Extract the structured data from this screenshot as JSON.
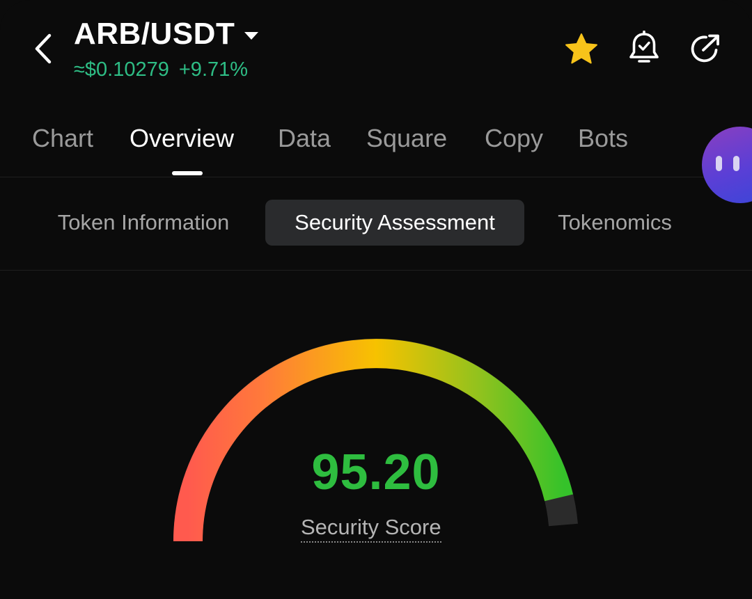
{
  "header": {
    "pair": "ARB/USDT",
    "price": "≈$0.10279",
    "change": "+9.71%",
    "icons": [
      "back-arrow-icon",
      "favorite-star-icon",
      "price-alert-bell-icon",
      "share-icon"
    ]
  },
  "main_tabs": [
    {
      "label": "Chart"
    },
    {
      "label": "Overview",
      "active": true
    },
    {
      "label": "Data"
    },
    {
      "label": "Square"
    },
    {
      "label": "Copy"
    },
    {
      "label": "Bots"
    }
  ],
  "sub_tabs": [
    {
      "label": "Token Information"
    },
    {
      "label": "Security Assessment",
      "active": true
    },
    {
      "label": "Tokenomics"
    }
  ],
  "security": {
    "score": "95.20",
    "score_fraction": 0.952,
    "label": "Security Score"
  },
  "colors": {
    "positive": "#2ebd85",
    "score": "#2ebd3f",
    "gauge_low": "#ff5a4e",
    "gauge_mid": "#f7c200",
    "gauge_high": "#35c22a",
    "star": "#f7c31a"
  }
}
